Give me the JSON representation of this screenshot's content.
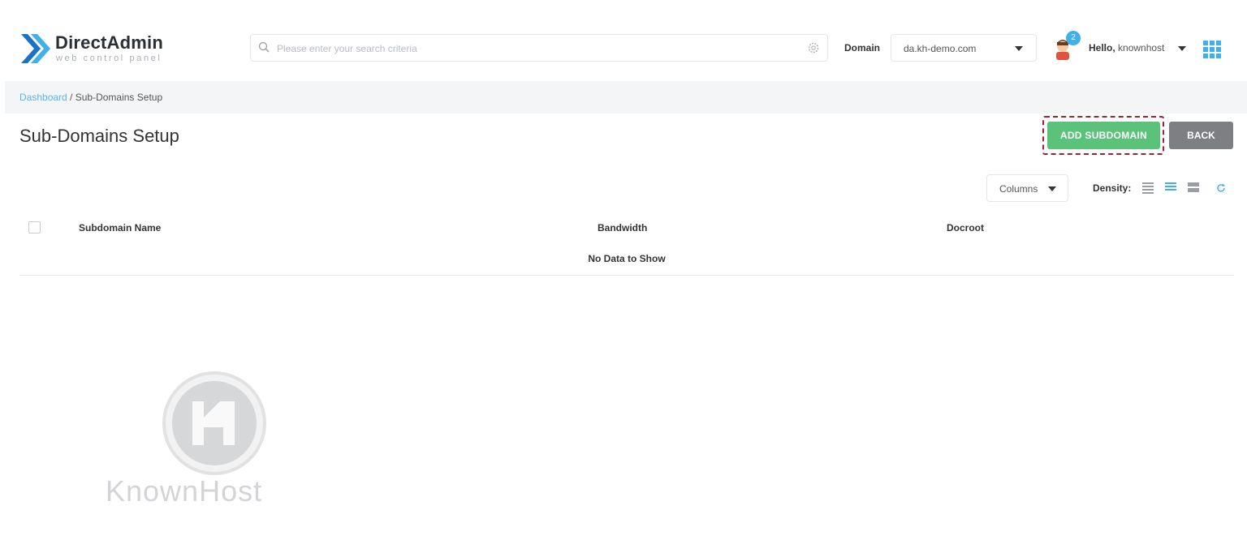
{
  "header": {
    "logo": {
      "title": "DirectAdmin",
      "subtitle": "web control panel"
    },
    "search": {
      "placeholder": "Please enter your search criteria"
    },
    "domain_label": "Domain",
    "domain_value": "da.kh-demo.com",
    "notification_count": "2",
    "greeting": "Hello,",
    "username": "knownhost"
  },
  "breadcrumb": {
    "root": "Dashboard",
    "separator": " / ",
    "current": "Sub-Domains Setup"
  },
  "page": {
    "title": "Sub-Domains Setup",
    "add_button": "ADD SUBDOMAIN",
    "back_button": "BACK"
  },
  "toolbar": {
    "columns_label": "Columns",
    "density_label": "Density:"
  },
  "table": {
    "columns": [
      "Subdomain Name",
      "Bandwidth",
      "Docroot"
    ],
    "empty_message": "No Data to Show"
  },
  "watermark": {
    "text": "KnownHost"
  },
  "colors": {
    "add_button": "#5bc27a",
    "back_button": "#7d7f82",
    "link": "#5ab3e8",
    "accent": "#3fb0ea",
    "highlight_border": "#a31f34"
  }
}
